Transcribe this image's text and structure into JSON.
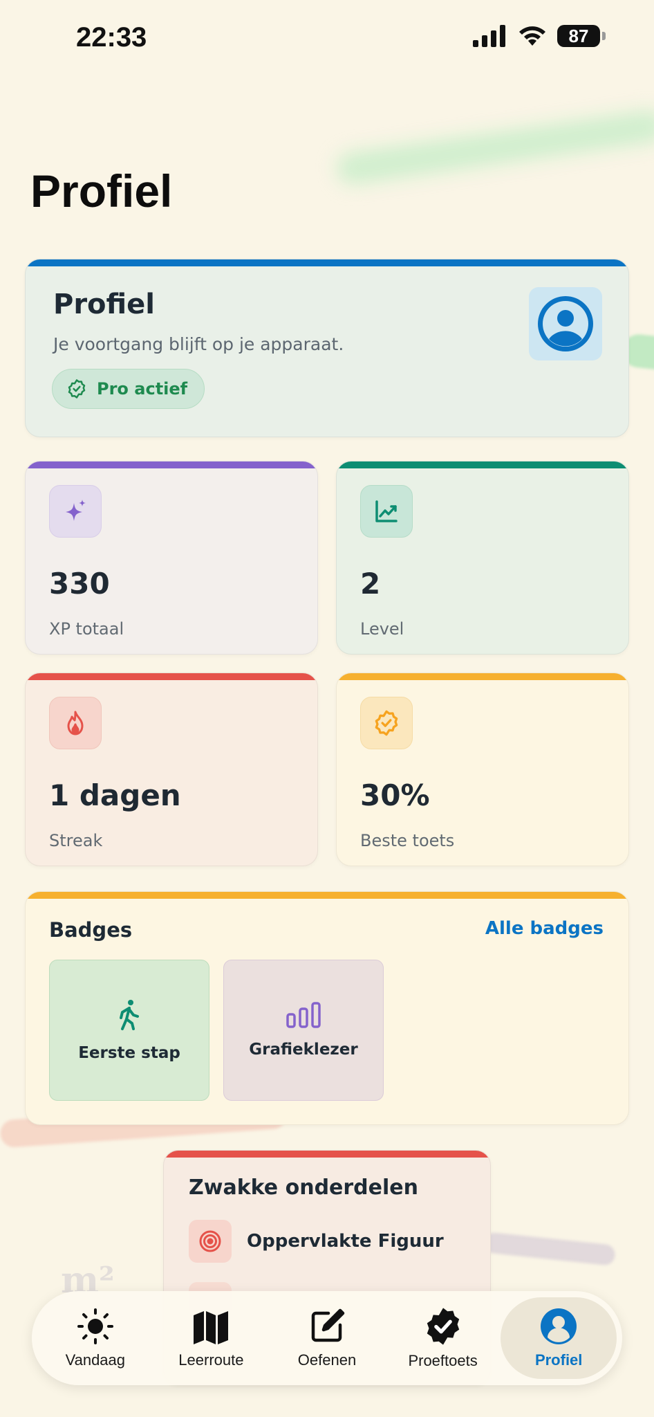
{
  "status": {
    "time": "22:33",
    "battery": "87"
  },
  "page": {
    "title": "Profiel"
  },
  "profile": {
    "title": "Profiel",
    "subtitle": "Je voortgang blijft op je apparaat.",
    "pro_label": "Pro actief",
    "accent": "#0b74c4"
  },
  "stats": [
    {
      "value": "330",
      "label": "XP totaal",
      "icon": "sparkles-icon",
      "color": "#8462cc"
    },
    {
      "value": "2",
      "label": "Level",
      "icon": "chart-line-icon",
      "color": "#0d8d72"
    },
    {
      "value": "1 dagen",
      "label": "Streak",
      "icon": "flame-icon",
      "color": "#e5524a"
    },
    {
      "value": "30%",
      "label": "Beste toets",
      "icon": "verified-badge-icon",
      "color": "#f6b02f"
    }
  ],
  "badges": {
    "title": "Badges",
    "link": "Alle badges",
    "items": [
      {
        "name": "Eerste stap",
        "icon": "walking-person-icon"
      },
      {
        "name": "Grafieklezer",
        "icon": "bar-chart-icon"
      }
    ]
  },
  "weak": {
    "title": "Zwakke onderdelen",
    "items": [
      {
        "name": "Oppervlakte Figuur",
        "icon": "target-icon"
      }
    ]
  },
  "tabs": [
    {
      "label": "Vandaag",
      "icon": "sun-icon"
    },
    {
      "label": "Leerroute",
      "icon": "map-icon"
    },
    {
      "label": "Oefenen",
      "icon": "edit-icon"
    },
    {
      "label": "Proeftoets",
      "icon": "check-seal-icon"
    },
    {
      "label": "Profiel",
      "icon": "profile-icon",
      "active": true
    }
  ]
}
